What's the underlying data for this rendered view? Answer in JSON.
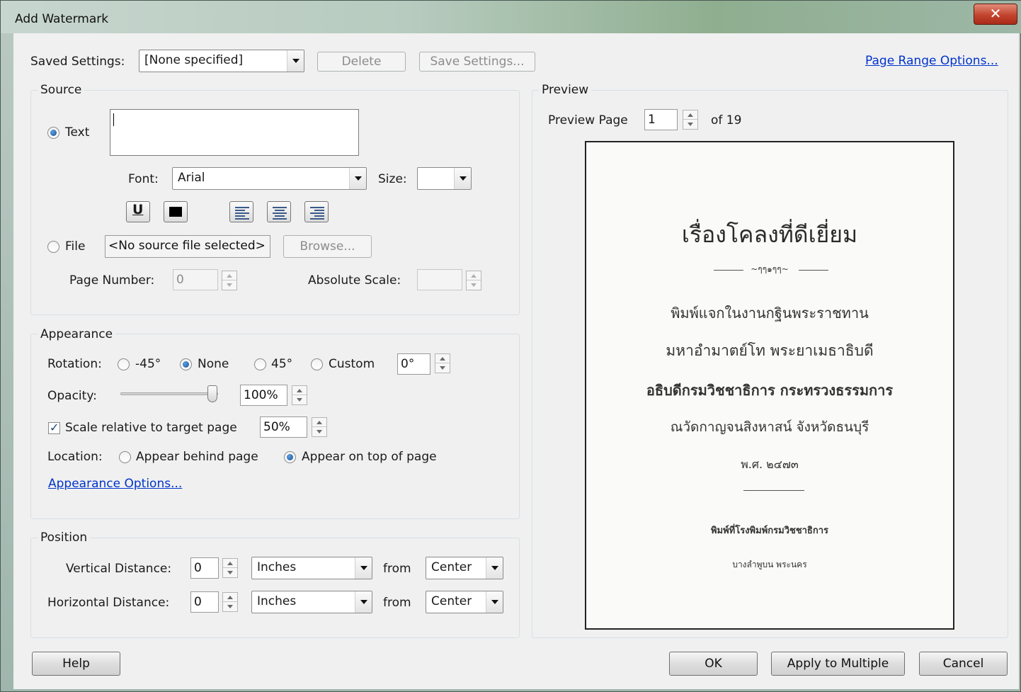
{
  "window": {
    "title": "Add Watermark",
    "close_label": "✕"
  },
  "top": {
    "saved_settings_label": "Saved Settings:",
    "saved_settings_value": "[None specified]",
    "delete_label": "Delete",
    "save_settings_label": "Save Settings...",
    "page_range_link": "Page Range Options..."
  },
  "source": {
    "title": "Source",
    "text_radio_label": "Text",
    "text_value": "",
    "font_label": "Font:",
    "font_value": "Arial",
    "size_label": "Size:",
    "size_value": "",
    "format_icons": [
      "underline-icon",
      "color-swatch-icon",
      "align-left-icon",
      "align-center-icon",
      "align-right-icon"
    ],
    "file_radio_label": "File",
    "file_value": "<No source file selected>",
    "browse_label": "Browse...",
    "page_number_label": "Page Number:",
    "page_number_value": "0",
    "absolute_scale_label": "Absolute Scale:",
    "absolute_scale_value": ""
  },
  "appearance": {
    "title": "Appearance",
    "rotation_label": "Rotation:",
    "rotation_options": [
      "-45°",
      "None",
      "45°",
      "Custom"
    ],
    "rotation_selected": "None",
    "rotation_custom_value": "0°",
    "opacity_label": "Opacity:",
    "opacity_value": "100%",
    "opacity_level": 1.0,
    "scale_label": "Scale relative to target page",
    "scale_checked": true,
    "scale_value": "50%",
    "location_label": "Location:",
    "location_options": [
      "Appear behind page",
      "Appear on top of page"
    ],
    "location_selected": "Appear on top of page",
    "options_link": "Appearance Options..."
  },
  "position": {
    "title": "Position",
    "vertical_label": "Vertical Distance:",
    "vertical_value": "0",
    "vertical_unit": "Inches",
    "vertical_from_label": "from",
    "vertical_from": "Center",
    "horizontal_label": "Horizontal Distance:",
    "horizontal_value": "0",
    "horizontal_unit": "Inches",
    "horizontal_from_label": "from",
    "horizontal_from": "Center"
  },
  "preview": {
    "title": "Preview",
    "page_label": "Preview Page",
    "page_value": "1",
    "of_label": "of 19",
    "page_lines": [
      "เรื่องโคลงที่ดีเยี่ยม",
      "~ๆๆ๑ๆๆ~",
      "พิมพ์แจกในงานกฐินพระราชทาน",
      "มหาอำมาตย์โท  พระยาเมธาธิบดี",
      "อธิบดีกรมวิชชาธิการ  กระทรวงธรรมการ",
      "ณวัดกาญจนสิงหาสน์  จังหวัดธนบุรี",
      "พ.ศ.  ๒๔๗๓",
      "พิมพ์ที่โรงพิมพ์กรมวิชชาธิการ",
      "บางลำพูบน  พระนคร"
    ]
  },
  "bottom": {
    "help_label": "Help",
    "ok_label": "OK",
    "apply_multiple_label": "Apply to Multiple",
    "cancel_label": "Cancel"
  }
}
